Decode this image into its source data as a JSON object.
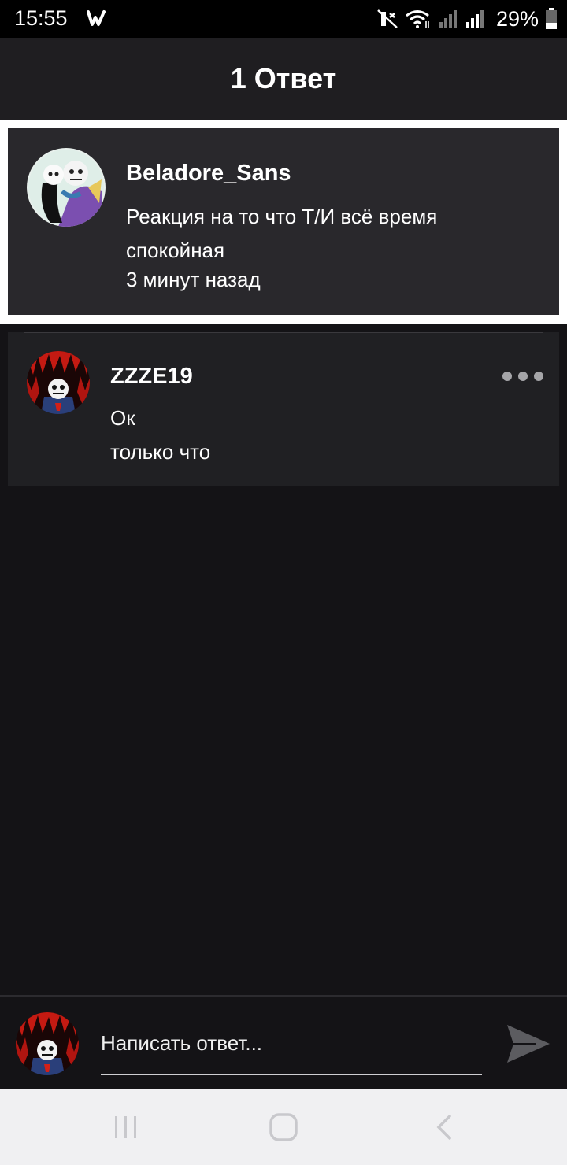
{
  "status_bar": {
    "time": "15:55",
    "app_icon": "wattpad-w-icon",
    "icons": [
      "mute-icon",
      "wifi-icon",
      "signal-icon",
      "signal-icon",
      "battery-icon"
    ],
    "battery": "29%"
  },
  "header": {
    "title": "1 Ответ"
  },
  "parent_comment": {
    "author": "Beladore_Sans",
    "text": "Реакция на то что Т/И всё время спокойная",
    "time": "3 минут назад"
  },
  "replies": [
    {
      "author": "ZZZE19",
      "text": "Ок",
      "time": "только что"
    }
  ],
  "composer": {
    "placeholder": "Написать ответ..."
  },
  "colors": {
    "background": "#141316",
    "card": "#29282c",
    "reply_card": "#202023",
    "header": "#1f1e21",
    "nav_bar": "#f0f0f2"
  }
}
